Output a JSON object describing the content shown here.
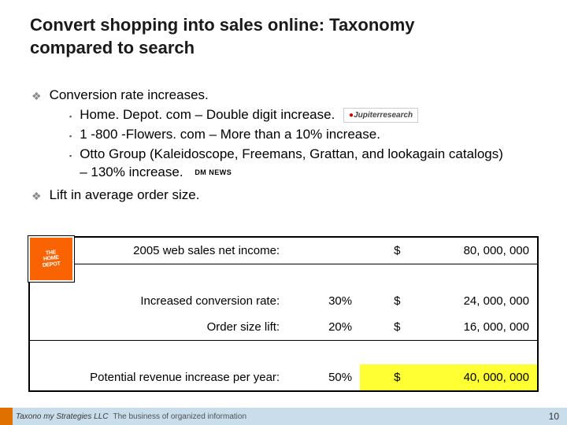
{
  "title": "Convert shopping into sales online: Taxonomy compared to search",
  "bullets": {
    "b1": "Conversion rate increases.",
    "s1": "Home. Depot. com – Double digit increase.",
    "s2": "1 -800 -Flowers. com – More than a 10% increase.",
    "s3": "Otto Group (Kaleidoscope, Freemans, Grattan, and lookagain catalogs) – 130%  increase.",
    "b2": "Lift in average order size."
  },
  "logos": {
    "jupiter": "Jupiterresearch",
    "dm": "DM NEWS",
    "thd_l1": "THE",
    "thd_l2": "HOME",
    "thd_l3": "DEPOT"
  },
  "table": {
    "r1_label": "2005 web sales net income:",
    "r1_pct": "",
    "r1_dollar": "$",
    "r1_val": "80, 000, 000",
    "r2_label": "Increased conversion rate:",
    "r2_pct": "30%",
    "r2_dollar": "$",
    "r2_val": "24, 000, 000",
    "r3_label": "Order size lift:",
    "r3_pct": "20%",
    "r3_dollar": "$",
    "r3_val": "16, 000, 000",
    "r4_label": "Potential revenue increase per year:",
    "r4_pct": "50%",
    "r4_dollar": "$",
    "r4_val": "40, 000, 000"
  },
  "footer": {
    "brand": "Taxono my Strategies LLC",
    "tag": "The business of organized information",
    "page": "10"
  },
  "chart_data": {
    "type": "table",
    "title": "Potential revenue increase calculation (Home Depot example)",
    "rows": [
      {
        "label": "2005 web sales net income",
        "percent": null,
        "amount_usd": 80000000
      },
      {
        "label": "Increased conversion rate",
        "percent": 30,
        "amount_usd": 24000000
      },
      {
        "label": "Order size lift",
        "percent": 20,
        "amount_usd": 16000000
      },
      {
        "label": "Potential revenue increase per year",
        "percent": 50,
        "amount_usd": 40000000
      }
    ]
  }
}
